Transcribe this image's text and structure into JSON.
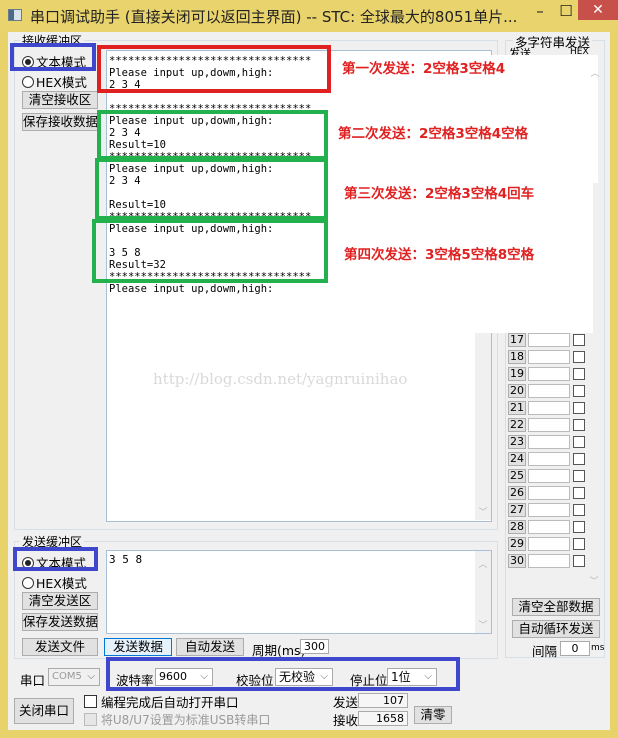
{
  "window": {
    "title": "串口调试助手 (直接关闭可以返回主界面) -- STC: 全球最大的8051单片...",
    "minimize_glyph": "–",
    "maximize_glyph": "☐",
    "close_glyph": "✕"
  },
  "receive": {
    "group_label": "接收缓冲区",
    "mode_text": "文本模式",
    "mode_hex": "HEX模式",
    "selected_mode": "text",
    "clear_button": "清空接收区",
    "save_button": "保存接收数据",
    "content": "********************************\nPlease input up,dowm,high:\n2 3 4\n\n********************************\nPlease input up,dowm,high:\n2 3 4\nResult=10\n********************************\nPlease input up,dowm,high:\n2 3 4\n\nResult=10\n********************************\nPlease input up,dowm,high:\n\n3 5 8\nResult=32\n********************************\nPlease input up,dowm,high:"
  },
  "annotations": [
    {
      "label": "第一次发送：2空格3空格4",
      "color": "#e02121"
    },
    {
      "label": "第二次发送：2空格3空格4空格",
      "color": "#22b14c"
    },
    {
      "label": "第三次发送：2空格3空格4回车",
      "color": "#22b14c"
    },
    {
      "label": "第四次发送：3空格5空格8空格",
      "color": "#22b14c"
    }
  ],
  "watermark": "http://blog.csdn.net/yagnruinihao",
  "multi_send": {
    "group_label": "多字符串发送",
    "col_send": "发送",
    "col_hex": "HEX",
    "rows": [
      {
        "num": "17"
      },
      {
        "num": "18"
      },
      {
        "num": "19"
      },
      {
        "num": "20"
      },
      {
        "num": "21"
      },
      {
        "num": "22"
      },
      {
        "num": "23"
      },
      {
        "num": "24"
      },
      {
        "num": "25"
      },
      {
        "num": "26"
      },
      {
        "num": "27"
      },
      {
        "num": "28"
      },
      {
        "num": "29"
      },
      {
        "num": "30"
      }
    ],
    "clear_all_button": "清空全部数据",
    "auto_loop_button": "自动循环发送",
    "interval_label": "间隔",
    "interval_value": "0",
    "interval_unit": "ms"
  },
  "send": {
    "group_label": "发送缓冲区",
    "mode_text": "文本模式",
    "mode_hex": "HEX模式",
    "selected_mode": "text",
    "clear_button": "清空发送区",
    "save_button": "保存发送数据",
    "content": "3 5 8",
    "send_file_button": "发送文件",
    "send_data_button": "发送数据",
    "auto_send_button": "自动发送",
    "period_label": "周期(ms)",
    "period_value": "300"
  },
  "serial": {
    "port_label": "串口",
    "port_value": "COM5",
    "baud_label": "波特率",
    "baud_value": "9600",
    "parity_label": "校验位",
    "parity_value": "无校验",
    "stop_label": "停止位",
    "stop_value": "1位",
    "close_port_button": "关闭串口",
    "auto_open_label": "编程完成后自动打开串口",
    "auto_open_checked": false,
    "usb_label": "将U8/U7设置为标准USB转串口",
    "usb_checked": false
  },
  "counters": {
    "sent_label": "发送",
    "sent_value": "107",
    "recv_label": "接收",
    "recv_value": "1658",
    "reset_button": "清零"
  }
}
